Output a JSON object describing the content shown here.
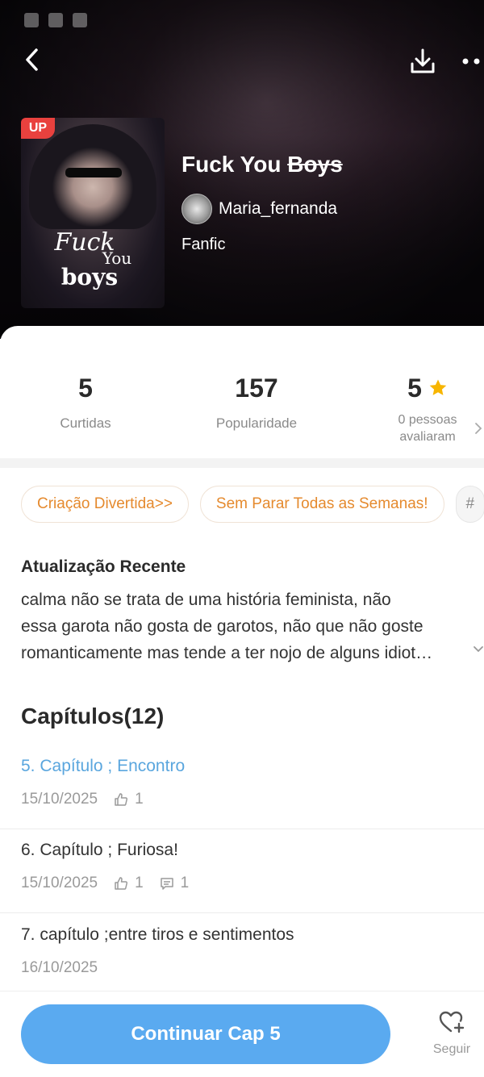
{
  "header": {
    "title": "Fuck You Boys",
    "title_plain": "Fuck You",
    "title_struck": "Boys",
    "author": "Maria_fernanda",
    "genre": "Fanfic",
    "badge": "UP",
    "cover_text": {
      "line1": "Fuck",
      "line2": "You",
      "line3": "boys"
    }
  },
  "stats": {
    "likes": {
      "value": "5",
      "label": "Curtidas"
    },
    "popularity": {
      "value": "157",
      "label": "Popularidade"
    },
    "rating": {
      "value": "5",
      "label_line1": "0 pessoas",
      "label_line2": "avaliaram"
    }
  },
  "tags": [
    "Criação Divertida>>",
    "Sem Parar Todas as Semanas!",
    "#"
  ],
  "update": {
    "title": "Atualização Recente",
    "lines": [
      "calma não se trata de uma história feminista, não",
      "essa garota não gosta de garotos, não que não goste",
      "romanticamente mas tende a ter nojo de alguns idiot…"
    ]
  },
  "chapters": {
    "title": "Capítulos(12)",
    "items": [
      {
        "title": "5. Capítulo ; Encontro",
        "date": "15/10/2025",
        "likes": "1",
        "comments": null,
        "active": true
      },
      {
        "title": "6. Capítulo ; Furiosa!",
        "date": "15/10/2025",
        "likes": "1",
        "comments": "1",
        "active": false
      },
      {
        "title": "7. capítulo ;entre tiros e sentimentos",
        "date": "16/10/2025",
        "likes": null,
        "comments": null,
        "active": false
      }
    ]
  },
  "bottom": {
    "continue_label": "Continuar Cap 5",
    "follow_label": "Seguir"
  },
  "colors": {
    "accent": "#5aaaf0",
    "tag_text": "#e58a2e",
    "active_chapter": "#5aa6de",
    "star": "#f7b500",
    "badge": "#e9413e"
  },
  "icons": [
    "back-arrow-icon",
    "download-icon",
    "more-icon",
    "star-icon",
    "like-icon",
    "comment-icon",
    "chevron-down-icon",
    "chevron-right-icon",
    "heart-plus-icon"
  ]
}
